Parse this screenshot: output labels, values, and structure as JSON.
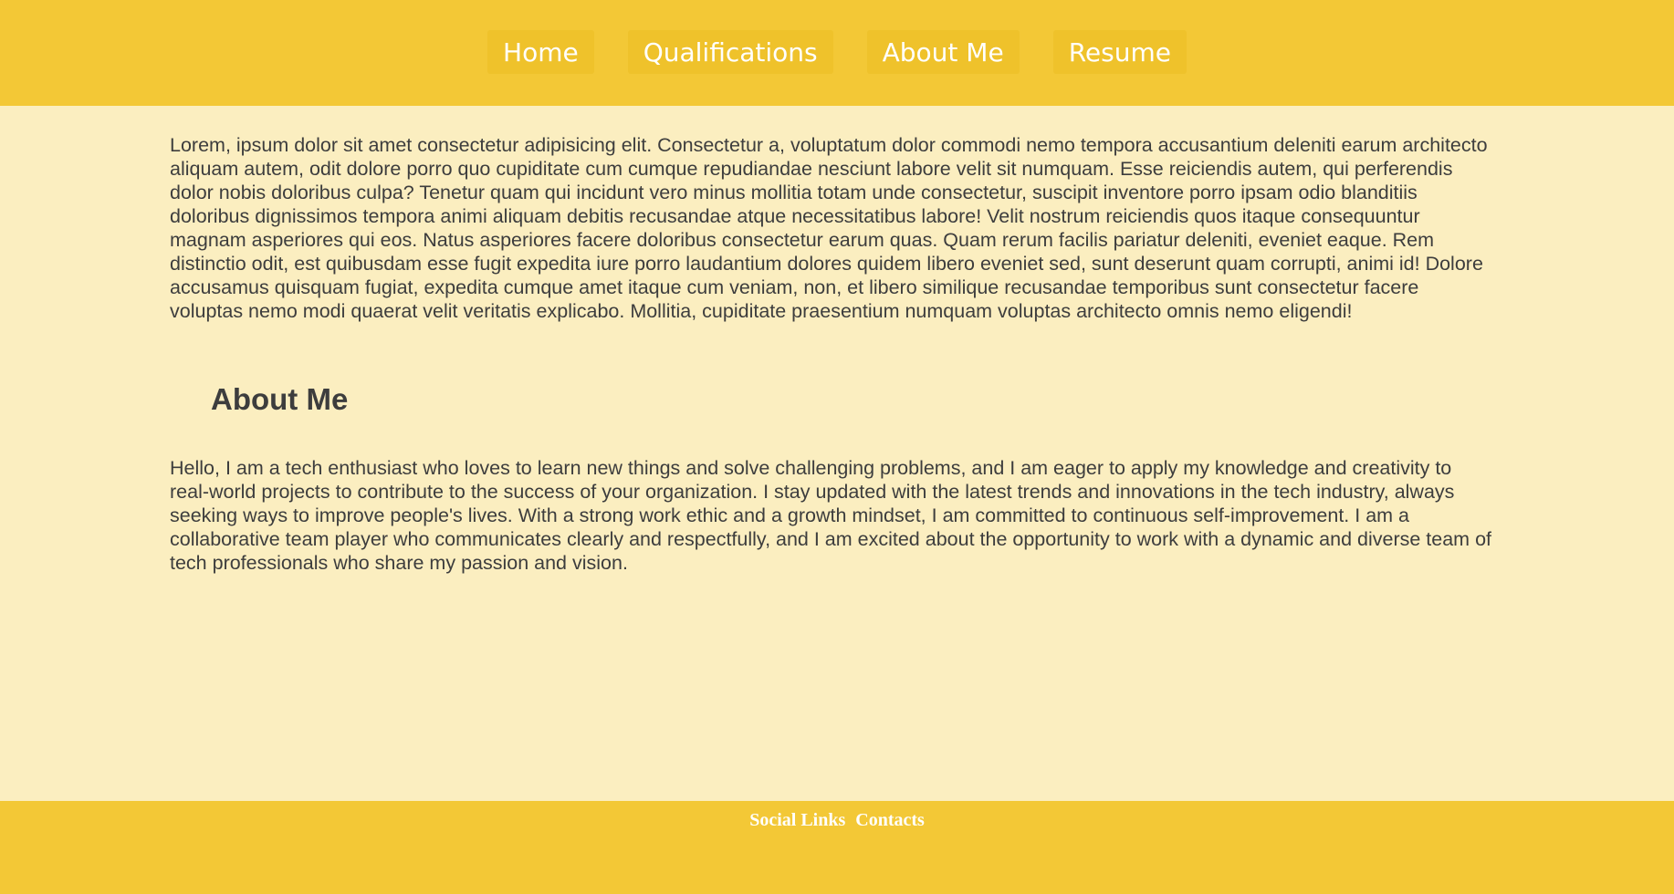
{
  "nav": {
    "items": [
      {
        "label": "Home"
      },
      {
        "label": "Qualifications"
      },
      {
        "label": "About Me"
      },
      {
        "label": "Resume"
      }
    ]
  },
  "main": {
    "intro": "Lorem, ipsum dolor sit amet consectetur adipisicing elit. Consectetur a, voluptatum dolor commodi nemo tempora accusantium deleniti earum architecto aliquam autem, odit dolore porro quo cupiditate cum cumque repudiandae nesciunt labore velit sit numquam. Esse reiciendis autem, qui perferendis dolor nobis doloribus culpa? Tenetur quam qui incidunt vero minus mollitia totam unde consectetur, suscipit inventore porro ipsam odio blanditiis doloribus dignissimos tempora animi aliquam debitis recusandae atque necessitatibus labore! Velit nostrum reiciendis quos itaque consequuntur magnam asperiores qui eos. Natus asperiores facere doloribus consectetur earum quas. Quam rerum facilis pariatur deleniti, eveniet eaque. Rem distinctio odit, est quibusdam esse fugit expedita iure porro laudantium dolores quidem libero eveniet sed, sunt deserunt quam corrupti, animi id! Dolore accusamus quisquam fugiat, expedita cumque amet itaque cum veniam, non, et libero similique recusandae temporibus sunt consectetur facere voluptas nemo modi quaerat velit veritatis explicabo. Mollitia, cupiditate praesentium numquam voluptas architecto omnis nemo eligendi!",
    "about_heading": "About Me",
    "about_text": "Hello, I am a tech enthusiast who loves to learn new things and solve challenging problems, and I am eager to apply my knowledge and creativity to real-world projects to contribute to the success of your organization. I stay updated with the latest trends and innovations in the tech industry, always seeking ways to improve people's lives. With a strong work ethic and a growth mindset, I am committed to continuous self-improvement. I am a collaborative team player who communicates clearly and respectfully, and I am excited about the opportunity to work with a dynamic and diverse team of tech professionals who share my passion and vision."
  },
  "footer": {
    "links": [
      {
        "label": "Social Links"
      },
      {
        "label": "Contacts"
      }
    ]
  },
  "colors": {
    "header_bg": "#f3c836",
    "button_bg": "#efc22b",
    "page_bg": "#fbeec0",
    "text": "#3d3d3d",
    "footer_bg": "#f3c836"
  }
}
